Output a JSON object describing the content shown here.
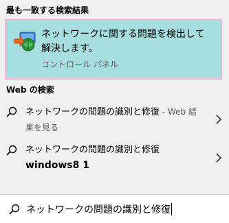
{
  "best_match": {
    "header": "最も一致する検索結果",
    "title": "ネットワークに関する問題を検出して解決します。",
    "subtitle": "コントロール パネル",
    "icon": "network-troubleshooter-icon"
  },
  "web_search": {
    "header": "Web の検索",
    "results": [
      {
        "text": "ネットワークの問題の識別と修復",
        "suffix": " - Web 結果を見る",
        "icon": "search-icon",
        "chevron": "chevron-right-icon"
      },
      {
        "text": "ネットワークの問題の識別と修復",
        "second_line": "windows8 1",
        "icon": "search-icon",
        "chevron": "chevron-right-icon"
      }
    ]
  },
  "search_box": {
    "value": "ネットワークの問題の識別と修復",
    "icon": "search-icon"
  },
  "colors": {
    "highlight": "#a7dfe0",
    "highlight_border": "#f2b8d0",
    "background": "#f0f0f0"
  }
}
